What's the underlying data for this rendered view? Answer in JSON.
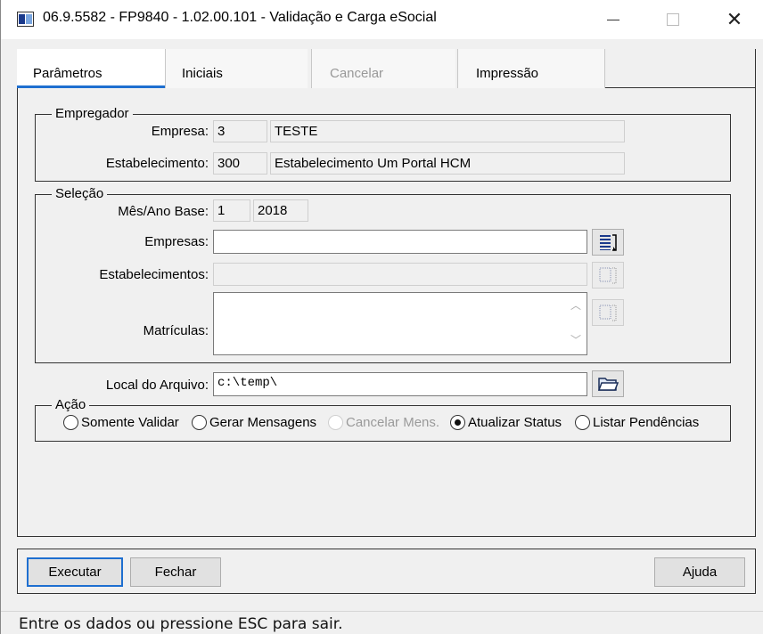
{
  "window": {
    "title": "06.9.5582 - FP9840 - 1.02.00.101 - Validação e Carga eSocial",
    "close_glyph": "✕"
  },
  "tabs": [
    {
      "label": "Parâmetros",
      "active": true
    },
    {
      "label": "Iniciais",
      "active": false
    },
    {
      "label": "Cancelar",
      "disabled": true
    },
    {
      "label": "Impressão",
      "active": false
    }
  ],
  "empregador": {
    "legend": "Empregador",
    "empresa_label": "Empresa:",
    "empresa_code": "3",
    "empresa_name": "TESTE",
    "estab_label": "Estabelecimento:",
    "estab_code": "300",
    "estab_name": "Estabelecimento Um Portal HCM"
  },
  "selecao": {
    "legend": "Seleção",
    "mes_ano_label": "Mês/Ano Base:",
    "mes": "1",
    "ano": "2018",
    "empresas_label": "Empresas:",
    "empresas_value": "",
    "estabelecimentos_label": "Estabelecimentos:",
    "estabelecimentos_value": "",
    "matriculas_label": "Matrículas:",
    "matriculas_value": ""
  },
  "arquivo": {
    "label": "Local do Arquivo:",
    "value": "c:\\temp\\"
  },
  "acao": {
    "legend": "Ação",
    "options": [
      {
        "label": "Somente Validar",
        "checked": false
      },
      {
        "label": "Gerar Mensagens",
        "checked": false
      },
      {
        "label": "Cancelar Mens.",
        "checked": false,
        "disabled": true
      },
      {
        "label": "Atualizar Status",
        "checked": true
      },
      {
        "label": "Listar Pendências",
        "checked": false
      }
    ]
  },
  "buttons": {
    "executar": "Executar",
    "fechar": "Fechar",
    "ajuda": "Ajuda"
  },
  "status": {
    "text": "Entre os dados ou pressione ESC para sair."
  },
  "colors": {
    "accent": "#1e6fd0",
    "list_icon": "#1b3a8c"
  }
}
